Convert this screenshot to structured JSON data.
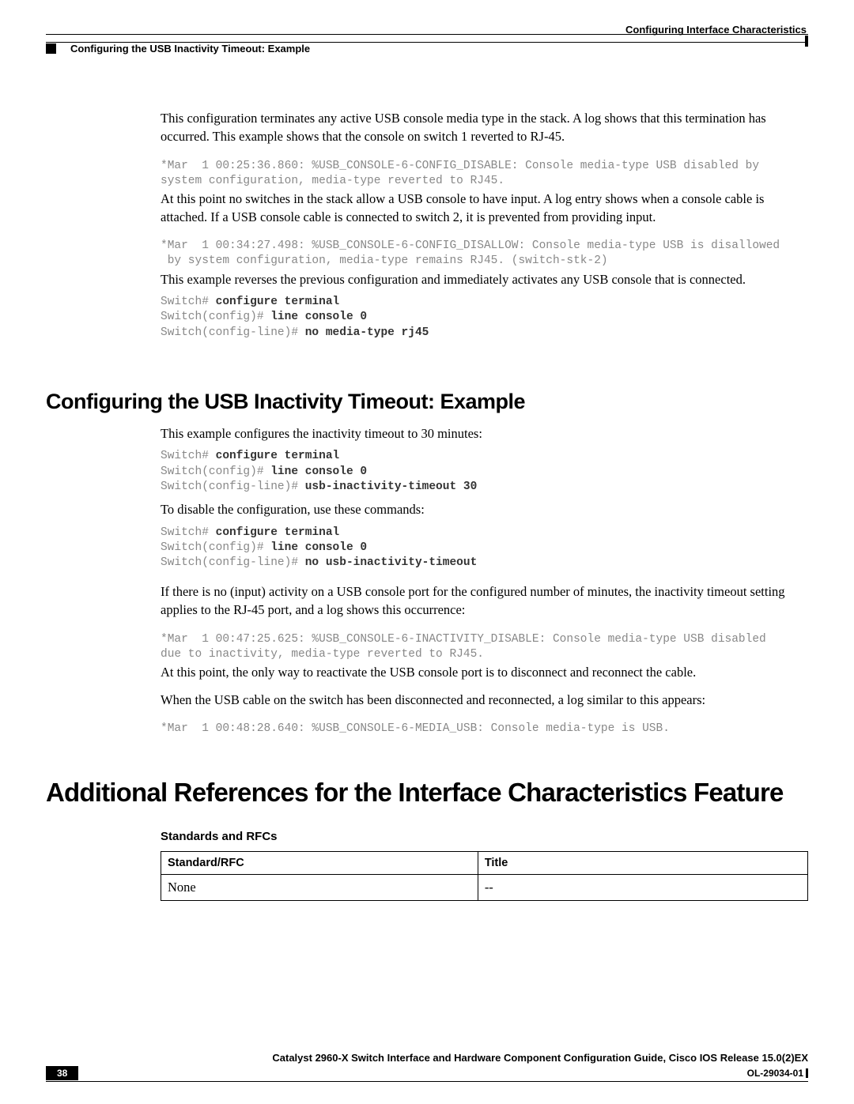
{
  "header": {
    "right": "Configuring Interface Characteristics",
    "left": "Configuring the USB Inactivity Timeout: Example"
  },
  "body": {
    "p1": "This configuration terminates any active USB console media type in the stack. A log shows that this termination has occurred. This example shows that the console on switch 1 reverted to RJ-45.",
    "log1": "*Mar  1 00:25:36.860: %USB_CONSOLE-6-CONFIG_DISABLE: Console media-type USB disabled by\nsystem configuration, media-type reverted to RJ45.",
    "p2": "At this point no switches in the stack allow a USB console to have input. A log entry shows when a console cable is attached. If a USB console cable is connected to switch 2, it is prevented from providing input.",
    "log2": "*Mar  1 00:34:27.498: %USB_CONSOLE-6-CONFIG_DISALLOW: Console media-type USB is disallowed\n by system configuration, media-type remains RJ45. (switch-stk-2)",
    "p3": "This example reverses the previous configuration and immediately activates any USB console that is connected.",
    "cmd1": {
      "l1a": "Switch# ",
      "l1b": "configure terminal",
      "l2a": "Switch(config)# ",
      "l2b": "line console 0",
      "l3a": "Switch(config-line)# ",
      "l3b": "no media-type rj45"
    },
    "h2": "Configuring the USB Inactivity Timeout: Example",
    "p4": "This example configures the inactivity timeout to 30 minutes:",
    "cmd2": {
      "l1a": "Switch# ",
      "l1b": "configure terminal",
      "l2a": "Switch(config)# ",
      "l2b": "line console 0",
      "l3a": "Switch(config-line)# ",
      "l3b": "usb-inactivity-timeout 30"
    },
    "p5": "To disable the configuration, use these commands:",
    "cmd3": {
      "l1a": "Switch# ",
      "l1b": "configure terminal",
      "l2a": "Switch(config)# ",
      "l2b": "line console 0",
      "l3a": "Switch(config-line)# ",
      "l3b": "no usb-inactivity-timeout"
    },
    "p6": "If there is no (input) activity on a USB console port for the configured number of minutes, the inactivity timeout setting applies to the RJ-45 port, and a log shows this occurrence:",
    "log3": "*Mar  1 00:47:25.625: %USB_CONSOLE-6-INACTIVITY_DISABLE: Console media-type USB disabled\ndue to inactivity, media-type reverted to RJ45.",
    "p7": "At this point, the only way to reactivate the USB console port is to disconnect and reconnect the cable.",
    "p8": "When the USB cable on the switch has been disconnected and reconnected, a log similar to this appears:",
    "log4": "*Mar  1 00:48:28.640: %USB_CONSOLE-6-MEDIA_USB: Console media-type is USB.",
    "h1": "Additional References for the Interface Characteristics Feature",
    "h3": "Standards and RFCs",
    "table": {
      "th1": "Standard/RFC",
      "th2": "Title",
      "td1": "None",
      "td2": "--"
    }
  },
  "footer": {
    "title": "Catalyst 2960-X Switch Interface and Hardware Component Configuration Guide, Cisco IOS Release 15.0(2)EX",
    "page": "38",
    "doc_id": "OL-29034-01"
  }
}
